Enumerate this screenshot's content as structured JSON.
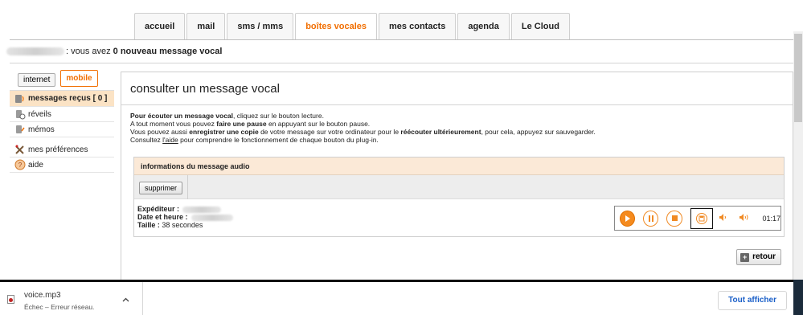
{
  "tabs": [
    {
      "label": "accueil",
      "active": false
    },
    {
      "label": "mail",
      "active": false
    },
    {
      "label": "sms / mms",
      "active": false
    },
    {
      "label": "boîtes vocales",
      "active": true
    },
    {
      "label": "mes contacts",
      "active": false
    },
    {
      "label": "agenda",
      "active": false
    },
    {
      "label": "Le Cloud",
      "active": false
    }
  ],
  "notice": {
    "prefix": ": vous avez",
    "count_text": "0 nouveau message vocal"
  },
  "sidebar": {
    "tabs": [
      {
        "label": "internet",
        "active": false
      },
      {
        "label": "mobile",
        "active": true
      }
    ],
    "items": [
      {
        "label": "messages reçus [ 0 ]",
        "icon": "voicemail-icon",
        "active": true
      },
      {
        "label": "réveils",
        "icon": "alarm-icon",
        "active": false
      },
      {
        "label": "mémos",
        "icon": "memo-icon",
        "active": false
      },
      {
        "label": "mes préférences",
        "icon": "preferences-icon",
        "active": false
      },
      {
        "label": "aide",
        "icon": "help-icon",
        "active": false
      }
    ]
  },
  "main": {
    "title": "consulter un message vocal",
    "instructions": {
      "l1_b": "Pour écouter un message vocal",
      "l1_r": ", cliquez sur le bouton lecture.",
      "l2_a": "A tout moment vous pouvez ",
      "l2_b": "faire une pause",
      "l2_c": " en appuyant sur le bouton pause.",
      "l3_a": "Vous pouvez aussi ",
      "l3_b": "enregistrer une copie",
      "l3_c": " de votre message sur votre ordinateur pour le ",
      "l3_d": "réécouter ultérieurement",
      "l3_e": ", pour cela, appuyez sur sauvegarder.",
      "l4_a": "Consultez ",
      "l4_link": "l'aide",
      "l4_c": " pour comprendre le fonctionnement de chaque bouton du plug-in."
    },
    "audio": {
      "header": "informations du message audio",
      "delete_label": "supprimer",
      "sender_label": "Expéditeur :",
      "datetime_label": "Date et heure :",
      "size_label": "Taille :",
      "size_value": "38 secondes",
      "time": "01:17"
    },
    "back_label": "retour"
  },
  "download": {
    "filename": "voice.mp3",
    "status": "Échec – Erreur réseau.",
    "show_all": "Tout afficher"
  },
  "colors": {
    "accent": "#f16e00",
    "header_bg": "#fbe9d7",
    "link": "#1a5fc8"
  }
}
